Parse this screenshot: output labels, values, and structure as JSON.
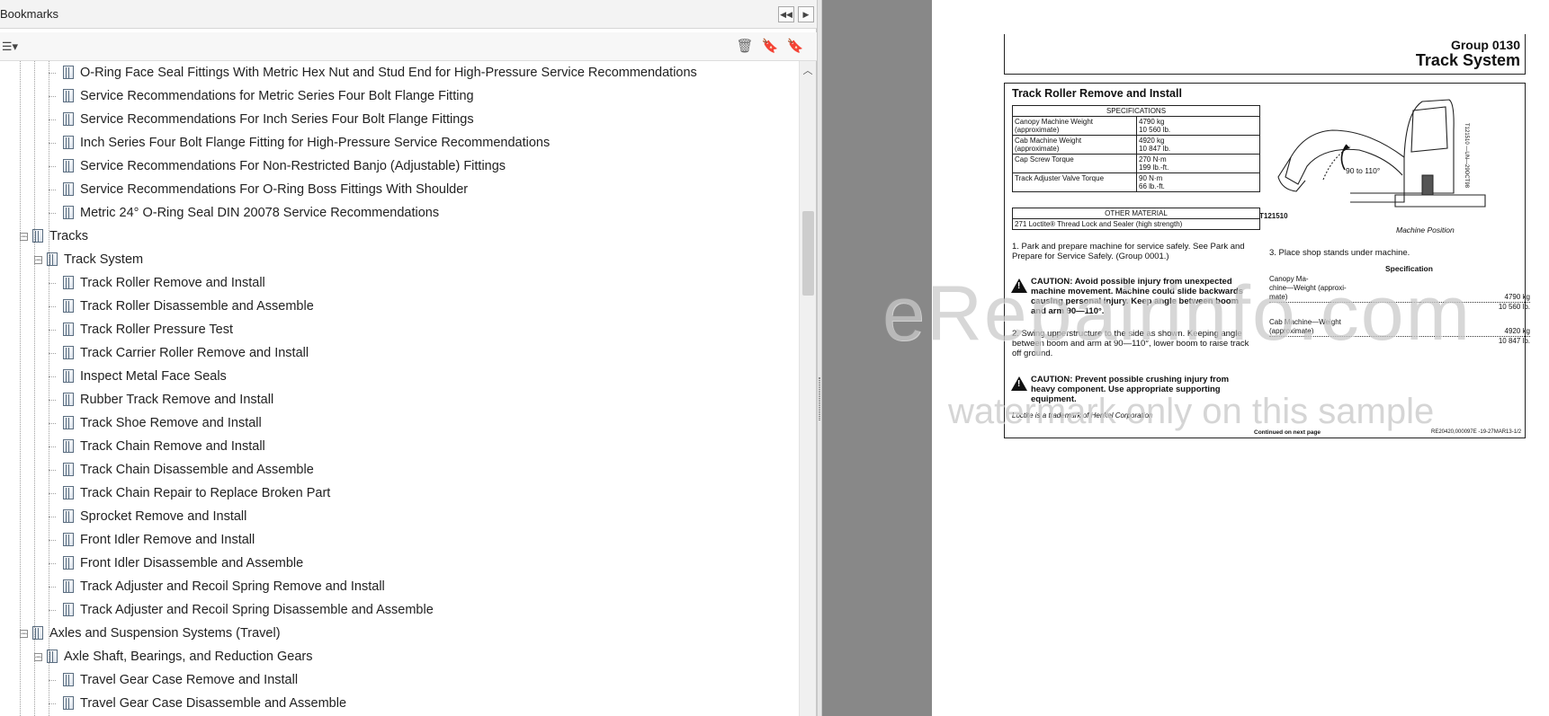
{
  "bookmarks": {
    "title": "Bookmarks",
    "rows": [
      {
        "label": "O-Ring Face Seal Fittings With Metric Hex Nut and Stud End for High-Pressure Service Recommendations",
        "level": 2
      },
      {
        "label": "Service Recommendations for Metric Series Four Bolt Flange Fitting",
        "level": 2
      },
      {
        "label": "Service Recommendations For Inch Series Four Bolt Flange Fittings",
        "level": 2
      },
      {
        "label": "Inch Series Four Bolt Flange Fitting for High-Pressure Service Recommendations",
        "level": 2
      },
      {
        "label": "Service Recommendations For Non-Restricted Banjo (Adjustable) Fittings",
        "level": 2
      },
      {
        "label": "Service Recommendations For O-Ring Boss Fittings With Shoulder",
        "level": 2
      },
      {
        "label": "Metric 24° O-Ring Seal DIN 20078 Service Recommendations",
        "level": 2
      },
      {
        "label": "Tracks",
        "level": 0,
        "expanded": true
      },
      {
        "label": "Track System",
        "level": 1,
        "expanded": true
      },
      {
        "label": "Track Roller Remove and Install",
        "level": 2
      },
      {
        "label": "Track Roller Disassemble and Assemble",
        "level": 2
      },
      {
        "label": "Track Roller Pressure Test",
        "level": 2
      },
      {
        "label": "Track Carrier Roller Remove and Install",
        "level": 2
      },
      {
        "label": "Inspect Metal Face Seals",
        "level": 2
      },
      {
        "label": "Rubber Track Remove and Install",
        "level": 2
      },
      {
        "label": "Track Shoe Remove and Install",
        "level": 2
      },
      {
        "label": "Track Chain Remove and Install",
        "level": 2
      },
      {
        "label": "Track Chain Disassemble and Assemble",
        "level": 2
      },
      {
        "label": "Track Chain Repair to Replace Broken Part",
        "level": 2
      },
      {
        "label": "Sprocket Remove and Install",
        "level": 2
      },
      {
        "label": "Front Idler Remove and Install",
        "level": 2
      },
      {
        "label": "Front Idler Disassemble and Assemble",
        "level": 2
      },
      {
        "label": "Track Adjuster and Recoil Spring Remove and Install",
        "level": 2
      },
      {
        "label": "Track Adjuster and Recoil Spring Disassemble and Assemble",
        "level": 2
      },
      {
        "label": "Axles and Suspension Systems (Travel)",
        "level": 0,
        "expanded": true
      },
      {
        "label": "Axle Shaft, Bearings, and Reduction Gears",
        "level": 1,
        "expanded": true
      },
      {
        "label": "Travel Gear Case Remove and Install",
        "level": 2
      },
      {
        "label": "Travel Gear Case Disassemble and Assemble",
        "level": 2
      }
    ]
  },
  "document": {
    "group": "Group  0130",
    "section_title": "Track System",
    "heading": "Track Roller Remove and Install",
    "spec_header": "SPECIFICATIONS",
    "spec_rows": [
      {
        "name_1": "Canopy Machine Weight",
        "name_2": "(approximate)",
        "val_1": "4790 kg",
        "val_2": "10 560 lb."
      },
      {
        "name_1": "Cab Machine Weight",
        "name_2": "(approximate)",
        "val_1": "4920 kg",
        "val_2": "10 847 lb."
      },
      {
        "name_1": "Cap Screw Torque",
        "name_2": "",
        "val_1": "270 N·m",
        "val_2": "199 lb.-ft."
      },
      {
        "name_1": "Track Adjuster Valve Torque",
        "name_2": "",
        "val_1": "90 N·m",
        "val_2": "66 lb.-ft."
      }
    ],
    "other_header": "OTHER MATERIAL",
    "other_item": "271 Loctite® Thread Lock and Sealer (high strength)",
    "step1": "1.  Park and prepare machine for service safely. See Park and Prepare for Service Safely. (Group 0001.)",
    "caution1": "CAUTION: Avoid possible injury from unexpected machine movement. Machine could slide backwards causing personal injury. Keep angle between boom and arm 90—110°.",
    "step2": "2.  Swing upperstructure to the side as shown. Keeping angle between boom and arm at 90—110°, lower boom to raise track off ground.",
    "caution2": "CAUTION: Prevent possible crushing injury from heavy component. Use appropriate supporting equipment.",
    "footnote": "Loctite is a trademark of Henkel Corporation",
    "continued": "Continued on next page",
    "doc_code": "RE20420,000097E -19-27MAR13-1/2",
    "figure_id": "T121510",
    "figure_side": "T121510 —UN—29OCT98",
    "figure_angle": "90 to 110°",
    "figure_caption": "Machine Position",
    "step3": "3.  Place shop stands under machine.",
    "spec2_title": "Specification",
    "spec2_1_label_1": "Canopy Ma-",
    "spec2_1_label_2": "chine—Weight (approxi-",
    "spec2_1_label_3": "mate)",
    "spec2_1_val_1": "4790 kg",
    "spec2_1_val_2": "10 560 lb.",
    "spec2_2_label_1": "Cab Machine—Weight",
    "spec2_2_label_2": "(approximate)",
    "spec2_2_val_1": "4920 kg",
    "spec2_2_val_2": "10 847 lb."
  },
  "watermark": {
    "line1": "eRepairinfo.com",
    "line2": "watermark only on this sample"
  },
  "icons": {
    "collapse": "collapse-pane-icon",
    "options": "options-menu-icon",
    "delete": "delete-bookmark-icon",
    "new": "new-bookmark-icon",
    "expand": "expand-bookmark-icon"
  }
}
